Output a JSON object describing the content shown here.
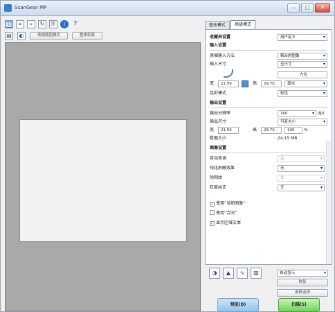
{
  "window": {
    "title": "ScanGear MP",
    "min": "—",
    "max": "□",
    "close": "✕"
  },
  "toolbar": {
    "btn_thumbnail": "按缩略图模式",
    "btn_whole": "整体影像"
  },
  "tabs": [
    "基本模式",
    "高级模式"
  ],
  "settings": {
    "favorite_label": "收藏夹设置",
    "favorite_value": "用户定义",
    "input_header": "输入设置",
    "paper_label": "原稿输入方法",
    "paper_value": "稿台的图像",
    "input_size_label": "输入尺寸",
    "input_size_value": "全尺寸",
    "orient_value": "方位",
    "w_label": "宽",
    "w_value": "21.59",
    "h_label": "高",
    "h_value": "29.70",
    "unit_value": "毫米",
    "color_mode_label": "色彩模式",
    "color_mode_value": "彩色",
    "output_header": "输出设置",
    "output_res_label": "输出分辨率",
    "output_res_value": "300",
    "output_res_unit": "dpi",
    "output_size_label": "输出尺寸",
    "output_size_value": "可变大小",
    "ow_value": "21.59",
    "oh_value": "29.70",
    "scale_value": "100",
    "scale_unit": "%",
    "data_size_label": "数据大小",
    "data_size_value": "24.15 MB",
    "image_header": "图像设置",
    "auto_tone_label": "自动色调",
    "auto_tone_value": "关",
    "unsharp_label": "钝化屏蔽效果",
    "unsharp_value": "无",
    "descreen_label": "除网纹",
    "descreen_value": "关",
    "grain_label": "粒度纠正",
    "grain_value": "无",
    "c1": "使用“当前图像”",
    "c2": "使用“合同”",
    "c3": "显示区域文本"
  },
  "bottom": {
    "mode_value": "自动显示",
    "btn_reset": "恢复",
    "btn_defaults": "参数选择",
    "btn_preview": "预览(D)",
    "btn_scan": "扫描(S)"
  }
}
